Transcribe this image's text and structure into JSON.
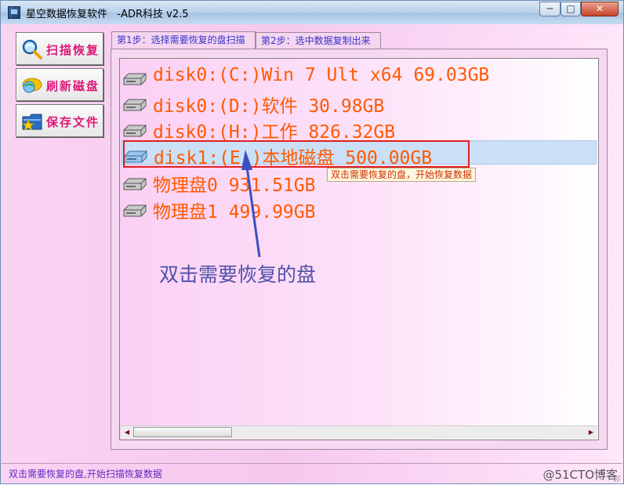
{
  "window": {
    "title": "星空数据恢复软件   -ADR科技 v2.5",
    "controls": {
      "minimize": "─",
      "maximize": "□",
      "close": "✕"
    }
  },
  "sidebar": {
    "buttons": [
      {
        "label": "扫描恢复",
        "icon": "magnifier-icon"
      },
      {
        "label": "刷新磁盘",
        "icon": "globe-icon"
      },
      {
        "label": "保存文件",
        "icon": "folder-star-icon"
      }
    ]
  },
  "tabs": [
    {
      "label": "第1步：选择需要恢复的盘扫描",
      "active": true
    },
    {
      "label": "第2步：选中数据复制出来",
      "active": false
    }
  ],
  "disks": [
    {
      "label": "disk0:(C:)Win 7 Ult x64 69.03GB",
      "selected": false
    },
    {
      "label": "disk0:(D:)软件 30.98GB",
      "selected": false
    },
    {
      "label": "disk0:(H:)工作 826.32GB",
      "selected": false
    },
    {
      "label": "disk1:(E:)本地磁盘 500.00GB",
      "selected": true
    },
    {
      "label": "物理盘0 931.51GB",
      "selected": false
    },
    {
      "label": "物理盘1 499.99GB",
      "selected": false
    }
  ],
  "tooltip": "双击需要恢复的盘，开始恢复数据",
  "annotation": "双击需要恢复的盘",
  "status": {
    "text": "双击需要恢复的盘,开始扫描恢复数据",
    "watermark": "@51CTO博客"
  },
  "colors": {
    "disk_text": "#ff5a00",
    "button_text": "#e0177a",
    "tab_text": "#3535c8",
    "annotation": "#5050a8",
    "highlight_box": "#e02020"
  }
}
